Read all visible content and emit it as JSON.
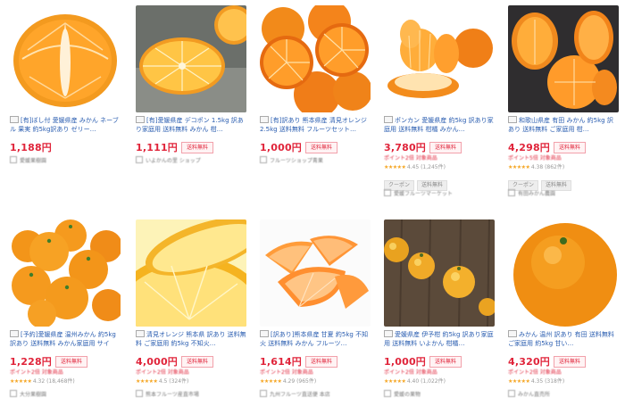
{
  "colors": {
    "price": "#e0243a",
    "link": "#2a5db0",
    "star": "#f5a623"
  },
  "products": [
    {
      "title": "[有]ぼし付 愛媛県産 みかん ネーブル 果実 約5kg訳あり ゼリー…",
      "price": "1,188",
      "yen": "円",
      "badge": "",
      "note": "",
      "rating": "",
      "tags": [],
      "shop": "愛媛果樹園",
      "image": "half-orange"
    },
    {
      "title": "[有]愛媛県産 デコポン 1.5kg 訳あり家庭用 送料無料 みかん 柑…",
      "price": "1,111",
      "yen": "円",
      "badge": "送料無料",
      "note": "",
      "rating": "",
      "tags": [],
      "shop": "いよかんの里 ショップ",
      "image": "slice-orange"
    },
    {
      "title": "[有]訳あり 熊本県産 清見オレンジ 2.5kg 送料無料 フルーツセット…",
      "price": "1,000",
      "yen": "円",
      "badge": "送料無料",
      "note": "",
      "rating": "",
      "tags": [],
      "shop": "フルーツショップ青果",
      "image": "pile-halves"
    },
    {
      "title": "ポンカン 愛媛県産 約5kg 訳あり家庭用 送料無料 柑橘 みかん…",
      "price": "3,780",
      "yen": "円",
      "badge": "送料無料",
      "note": "ポイント2倍 対象商品",
      "rating": "4.45 (1,245件)",
      "tags": [
        "クーポン",
        "送料無料"
      ],
      "shop": "愛媛フルーツマーケット",
      "image": "peeled"
    },
    {
      "title": "和歌山県産 有田 みかん 約5kg 訳あり 送料無料 ご家庭用 柑…",
      "price": "4,298",
      "yen": "円",
      "badge": "送料無料",
      "note": "ポイント5倍 対象商品",
      "rating": "4.38 (862件)",
      "tags": [
        "クーポン",
        "送料無料"
      ],
      "shop": "有田みかん農園",
      "image": "segments"
    },
    {
      "title": "[予約]愛媛県産 温州みかん 約5kg 訳あり 送料無料 みかん家庭用 サイズ…",
      "price": "1,228",
      "yen": "円",
      "badge": "送料無料",
      "note": "ポイント2倍 対象商品",
      "rating": "4.32 (18,468件)",
      "tags": [],
      "shop": "大分果樹園",
      "image": "whole-pile"
    },
    {
      "title": "清見オレンジ 熊本県 訳あり 送料無料 ご家庭用 約5kg 不知火…",
      "price": "4,000",
      "yen": "円",
      "badge": "送料無料",
      "note": "ポイント2倍 対象商品",
      "rating": "4.5 (324件)",
      "tags": [],
      "shop": "熊本フルーツ産直市場",
      "image": "closeup"
    },
    {
      "title": "[訳あり]熊本県産 甘夏 約5kg 不知火 送料無料 みかん フルーツ…",
      "price": "1,614",
      "yen": "円",
      "badge": "送料無料",
      "note": "ポイント2倍 対象商品",
      "rating": "4.29 (965件)",
      "tags": [],
      "shop": "九州フルーツ直送便 本店",
      "image": "wedges"
    },
    {
      "title": "愛媛県産 伊予柑 約5kg 訳あり家庭用 送料無料 いよかん 柑橘…",
      "price": "1,000",
      "yen": "円",
      "badge": "送料無料",
      "note": "ポイント2倍 対象商品",
      "rating": "4.40 (1,022件)",
      "tags": [],
      "shop": "愛媛の果物",
      "image": "on-table"
    },
    {
      "title": "みかん 温州 訳あり 有田 送料無料 ご家庭用 約5kg 甘い…",
      "price": "4,320",
      "yen": "円",
      "badge": "送料無料",
      "note": "ポイント2倍 対象商品",
      "rating": "4.35 (318件)",
      "tags": [],
      "shop": "みかん直売所",
      "image": "big-orange"
    }
  ]
}
